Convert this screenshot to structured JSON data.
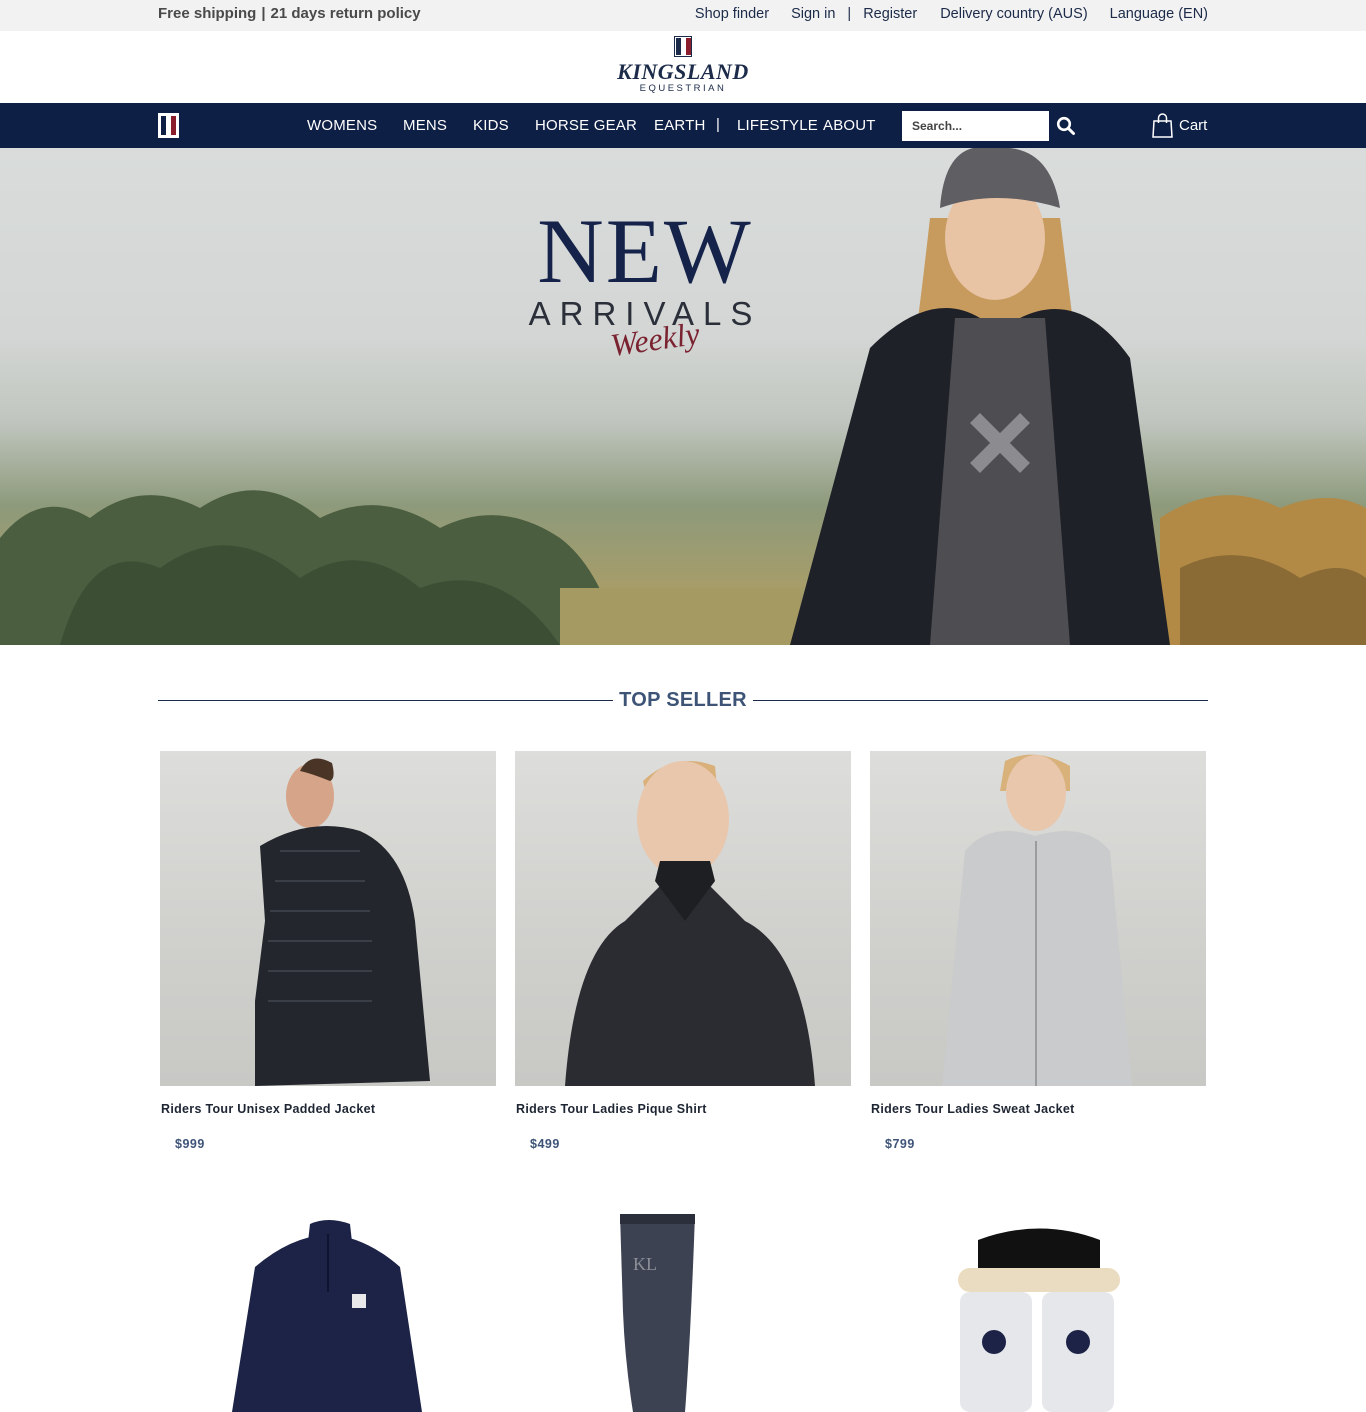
{
  "topbar": {
    "promo_shipping": "Free shipping",
    "promo_separator": "|",
    "promo_returns": "21 days return policy",
    "shop_finder": "Shop finder",
    "sign_in": "Sign in",
    "register": "Register",
    "delivery_country": "Delivery country (AUS)",
    "language": "Language (EN)"
  },
  "brand": {
    "name": "KINGSLAND",
    "subtitle": "EQUESTRIAN",
    "navy": "#0e1f45",
    "burgundy": "#8b1e2d"
  },
  "nav": {
    "items": [
      "WOMENS",
      "MENS",
      "KIDS",
      "HORSE GEAR",
      "EARTH",
      "LIFESTYLE",
      "ABOUT"
    ],
    "separator": "|",
    "search_placeholder": "Search...",
    "cart_label": "Cart"
  },
  "hero": {
    "headline": "NEW",
    "subheadline": "ARRIVALS",
    "script": "Weekly"
  },
  "top_seller": {
    "title": "TOP SELLER",
    "products": [
      {
        "name": "Riders Tour Unisex Padded Jacket",
        "price": "$999",
        "garment_color": "#23262c"
      },
      {
        "name": "Riders Tour Ladies Pique Shirt",
        "price": "$499",
        "garment_color": "#2a2c31"
      },
      {
        "name": "Riders Tour Ladies Sweat Jacket",
        "price": "$799",
        "garment_color": "#c9cbcc"
      }
    ],
    "more_products": [
      {
        "image": "navy-half-zip-shirt-icon"
      },
      {
        "image": "riding-sock-icon"
      },
      {
        "image": "fetlock-boots-icon"
      }
    ]
  }
}
